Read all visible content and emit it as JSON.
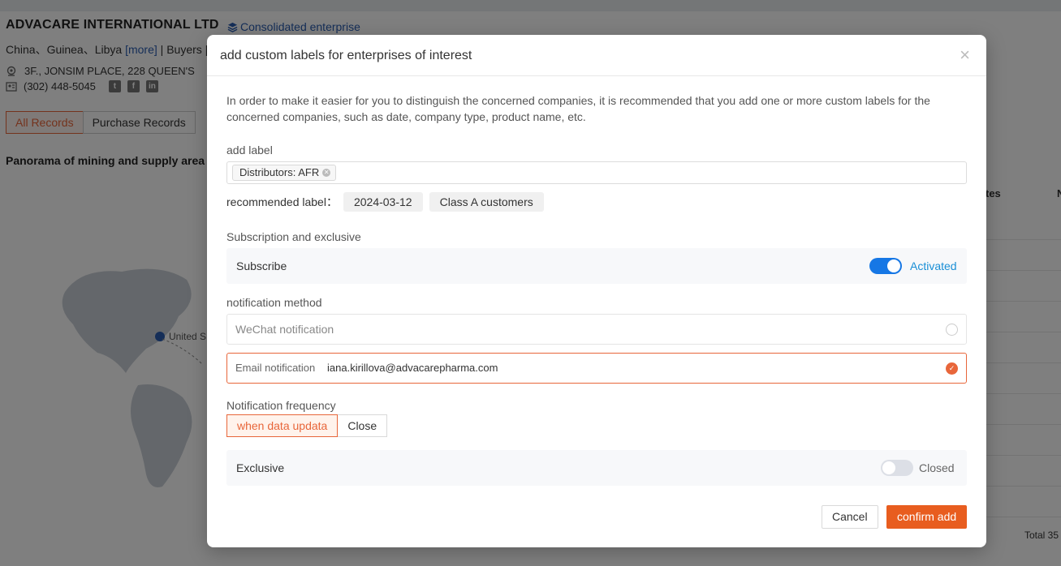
{
  "company": {
    "name": "ADVACARE INTERNATIONAL LTD",
    "consolidated": "Consolidated enterprise",
    "countries": "China、Guinea、Libya",
    "more": "[more]",
    "buyers": "| Buyers |",
    "address": "3F., JONSIM PLACE, 228 QUEEN'S",
    "phone": "(302) 448-5045"
  },
  "tabs": [
    "All Records",
    "Purchase Records"
  ],
  "panorama": "Panorama of mining and supply area",
  "map": {
    "marker_label": "United S"
  },
  "table": {
    "col_head": "tes",
    "col_head2": "N",
    "total": "Total 35"
  },
  "modal": {
    "title": "add custom labels for enterprises of interest",
    "close": "×",
    "intro": "In order to make it easier for you to distinguish the concerned companies, it is recommended that you add one or more custom labels for the concerned companies, such as date, company type, product name, etc.",
    "add_label": "add label",
    "tags": [
      "Distributors: AFR"
    ],
    "recommended_label": "recommended label：",
    "recommended": [
      "2024-03-12",
      "Class A customers"
    ],
    "subscription_title": "Subscription and exclusive",
    "subscribe": {
      "label": "Subscribe",
      "state": "Activated",
      "on": true
    },
    "notification_title": "notification method",
    "wechat": "WeChat notification",
    "email_label": "Email notification",
    "email_value": "iana.kirillova@advacarepharma.com",
    "frequency_title": "Notification frequency",
    "frequency": [
      "when data updata",
      "Close"
    ],
    "exclusive": {
      "label": "Exclusive",
      "state": "Closed",
      "on": false
    },
    "cancel": "Cancel",
    "confirm": "confirm add"
  },
  "colors": {
    "accent": "#e8663a",
    "primary": "#e85d1f",
    "switch_on": "#1677e5",
    "link": "#2a5db0"
  }
}
